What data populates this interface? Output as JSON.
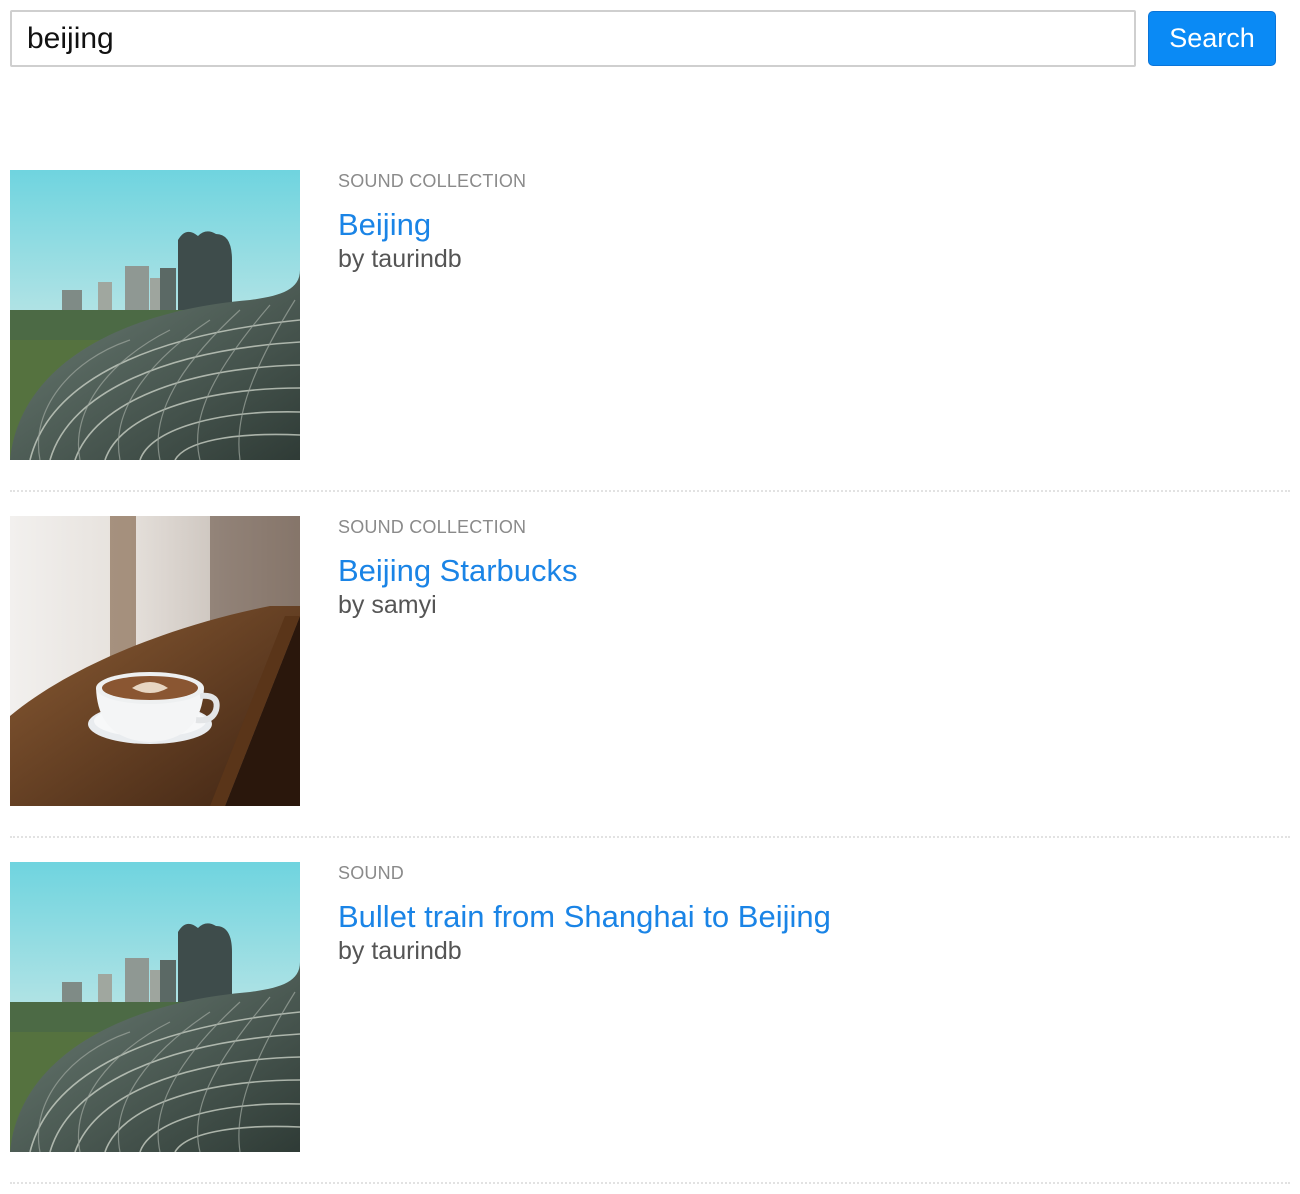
{
  "search": {
    "query": "beijing",
    "button_label": "Search"
  },
  "results": [
    {
      "kind": "SOUND COLLECTION",
      "title": "Beijing",
      "byline": "by taurindb",
      "thumbnail": "modern-architecture-city-skyline"
    },
    {
      "kind": "SOUND COLLECTION",
      "title": "Beijing Starbucks",
      "byline": "by samyi",
      "thumbnail": "coffee-cup-on-wooden-counter"
    },
    {
      "kind": "SOUND",
      "title": "Bullet train from Shanghai to Beijing",
      "byline": "by taurindb",
      "thumbnail": "modern-architecture-city-skyline"
    }
  ],
  "colors": {
    "accent": "#0a8af5",
    "link": "#1a84e6",
    "meta": "#8a8a8a",
    "byline": "#555555"
  }
}
